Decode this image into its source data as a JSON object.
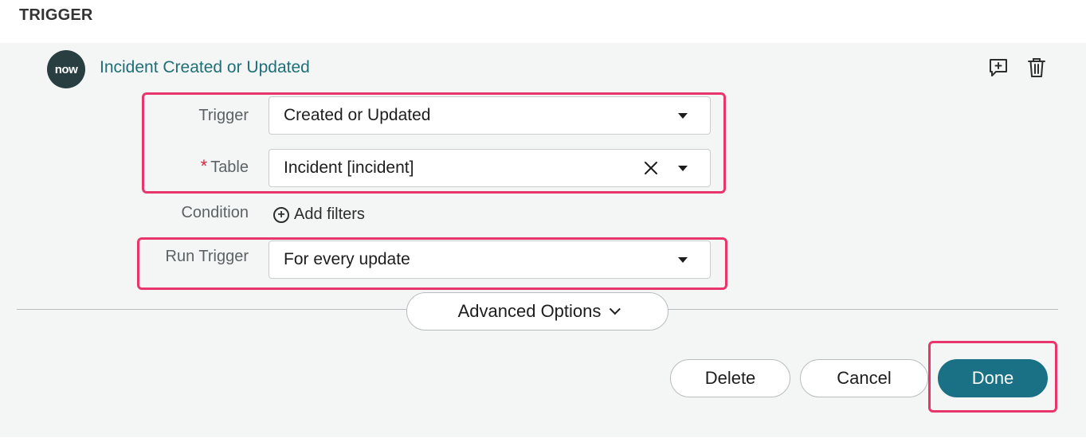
{
  "section": {
    "title": "TRIGGER"
  },
  "trigger": {
    "logo_text": "now",
    "name": "Incident Created or Updated"
  },
  "form": {
    "trigger_label": "Trigger",
    "trigger_value": "Created or Updated",
    "table_required_mark": "*",
    "table_label": "Table",
    "table_value": "Incident [incident]",
    "condition_label": "Condition",
    "add_filters_label": "Add filters",
    "run_trigger_label": "Run Trigger",
    "run_trigger_value": "For every update"
  },
  "advanced": {
    "label": "Advanced Options"
  },
  "actions": {
    "delete_label": "Delete",
    "cancel_label": "Cancel",
    "done_label": "Done"
  },
  "colors": {
    "accent": "#1a7185",
    "link": "#1f6f78",
    "highlight": "#e8366d",
    "required": "#d6263c",
    "logo_bg": "#293e40"
  },
  "icons": [
    "comment-add-icon",
    "trash-icon",
    "caret-down-icon",
    "clear-icon",
    "add-circle-icon",
    "chevron-down-icon"
  ]
}
